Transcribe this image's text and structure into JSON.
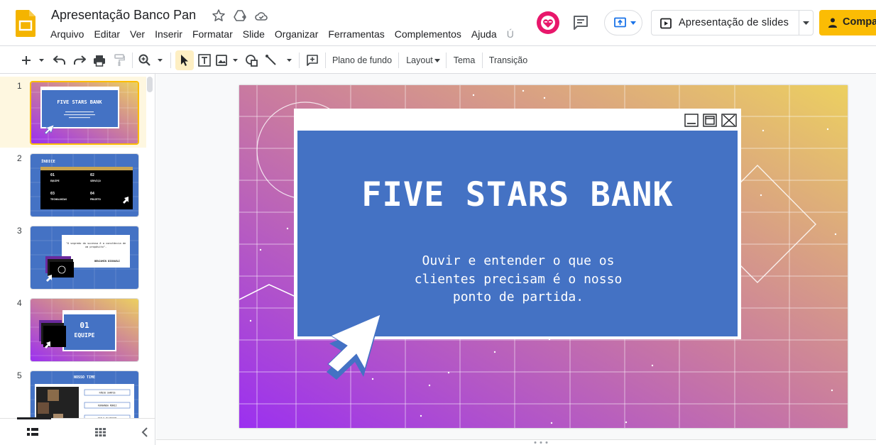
{
  "header": {
    "doc_title": "Apresentação Banco Pan",
    "icons": [
      "star-icon",
      "move-to-drive-icon",
      "cloud-saved-icon"
    ],
    "menu": [
      "Arquivo",
      "Editar",
      "Ver",
      "Inserir",
      "Formatar",
      "Slide",
      "Organizar",
      "Ferramentas",
      "Complementos",
      "Ajuda",
      "Ú"
    ],
    "slideshow_label": "Apresentação de slides",
    "share_label": "Compartilhar"
  },
  "toolbar": {
    "background": "Plano de fundo",
    "layout": "Layout",
    "theme": "Tema",
    "transition": "Transição"
  },
  "filmstrip": {
    "slides": [
      {
        "num": "1",
        "title": "FIVE STARS BANK",
        "subtitle": "Ouvir e entender o que os clientes precisam é o nosso ponto de partida."
      },
      {
        "num": "2",
        "title": "ÍNDICE",
        "items": [
          [
            "01",
            "EQUIPE"
          ],
          [
            "02",
            "SERVIÇO"
          ],
          [
            "03",
            "TECNOLOGIAS"
          ],
          [
            "04",
            "PROJETO"
          ]
        ]
      },
      {
        "num": "3",
        "quote": "\"O segredo do sucesso é a constância de um propósito\".",
        "author": "BENJAMIN DISRAELI"
      },
      {
        "num": "4",
        "number": "01",
        "label": "EQUIPE"
      },
      {
        "num": "5",
        "title": "NOSSO TIME",
        "names": [
          "FÁBIO SANTOS",
          "FERNANDA MUNIZ",
          "ITALO PLENSDOR"
        ]
      }
    ]
  },
  "slide": {
    "title": "FIVE STARS BANK",
    "subtitle_lines": [
      "Ouvir e entender o que os",
      "clientes precisam é o nosso",
      "ponto de partida."
    ]
  },
  "colors": {
    "accent": "#fbbc04",
    "slide_blue": "#4472c4",
    "grad_start": "#9b30f0",
    "grad_end": "#ecd060"
  }
}
